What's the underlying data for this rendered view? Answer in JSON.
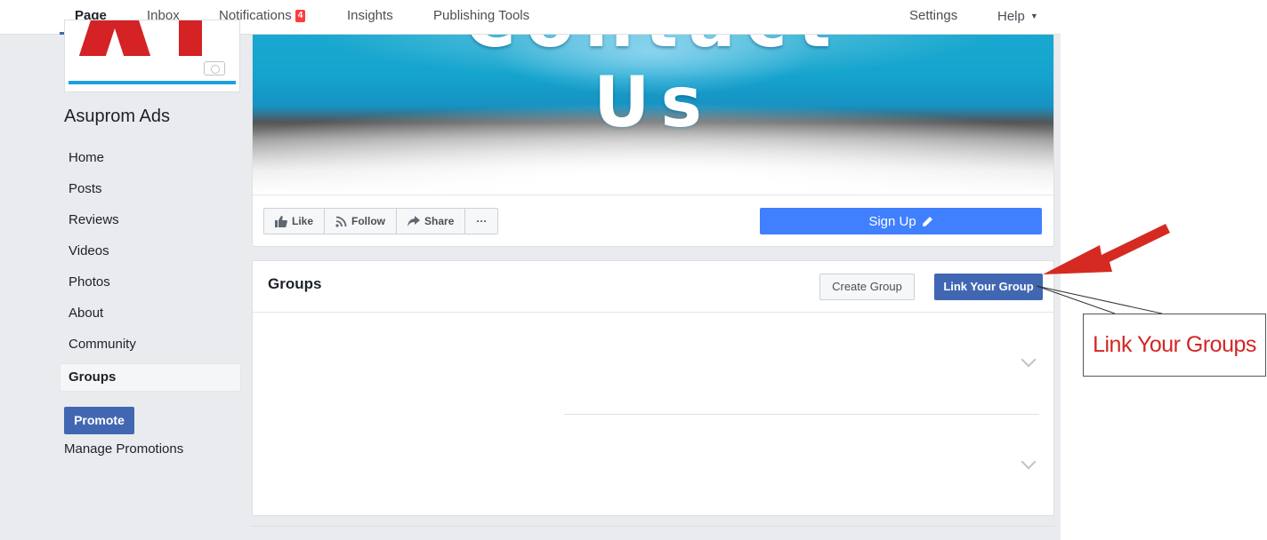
{
  "nav": {
    "tabs": [
      {
        "label": "Page"
      },
      {
        "label": "Inbox"
      },
      {
        "label": "Notifications",
        "badge": "4"
      },
      {
        "label": "Insights"
      },
      {
        "label": "Publishing Tools"
      }
    ],
    "settings_label": "Settings",
    "help_label": "Help"
  },
  "sidebar": {
    "page_name": "Asuprom Ads",
    "items": [
      {
        "label": "Home"
      },
      {
        "label": "Posts"
      },
      {
        "label": "Reviews"
      },
      {
        "label": "Videos"
      },
      {
        "label": "Photos"
      },
      {
        "label": "About"
      },
      {
        "label": "Community"
      },
      {
        "label": "Groups"
      }
    ],
    "promote_label": "Promote",
    "manage_promotions_label": "Manage Promotions"
  },
  "cover": {
    "cover_text": "Contact Us",
    "actions": {
      "like_label": "Like",
      "follow_label": "Follow",
      "share_label": "Share",
      "more_label": "···"
    },
    "signup_label": "Sign Up"
  },
  "groups": {
    "title": "Groups",
    "create_label": "Create Group",
    "link_label": "Link Your Group"
  },
  "annotation": {
    "callout_text": "Link Your Groups"
  },
  "colors": {
    "fb_blue": "#4267b2",
    "cta_blue": "#4080ff",
    "annotation_red": "#d22626",
    "badge_red": "#fa3e3e"
  }
}
